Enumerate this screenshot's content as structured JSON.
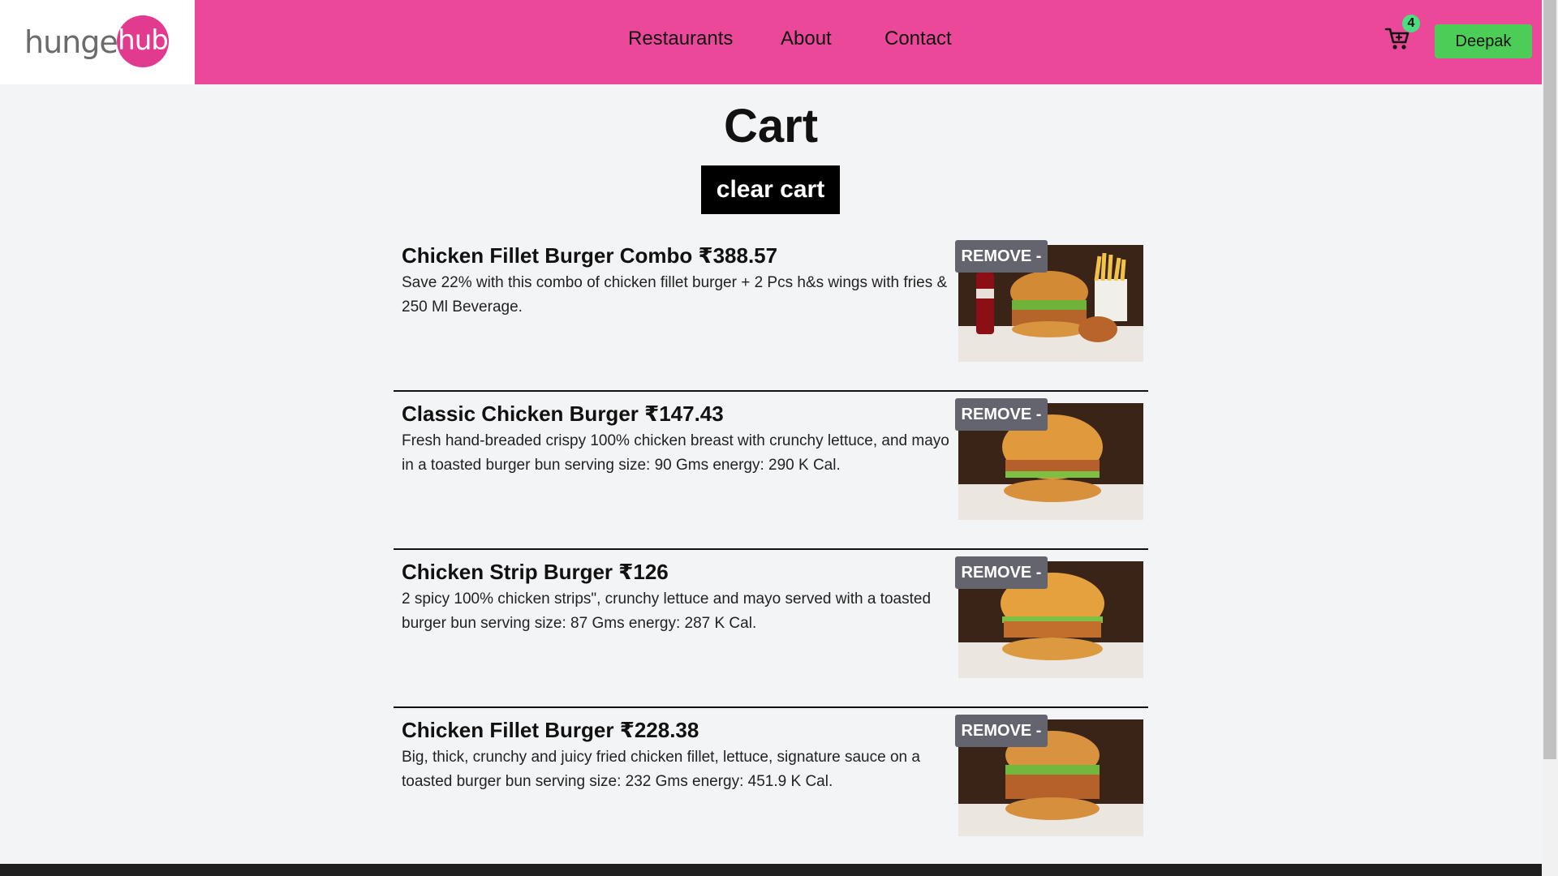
{
  "header": {
    "logo": {
      "left_text": "hunger",
      "right_text": "hub"
    },
    "nav": [
      {
        "label": "Restaurants"
      },
      {
        "label": "About"
      },
      {
        "label": "Contact"
      }
    ],
    "cart_count": "4",
    "user_label": "Deepak"
  },
  "main": {
    "title": "Cart",
    "clear_label": "clear cart",
    "items": [
      {
        "title": "Chicken Fillet Burger Combo ₹388.57",
        "description": "Save 22% with this combo of chicken fillet burger + 2 Pcs h&s wings with fries & 250 Ml Beverage.",
        "remove_label": "REMOVE -"
      },
      {
        "title": "Classic Chicken Burger ₹147.43",
        "description": "Fresh hand-breaded crispy 100% chicken breast with crunchy lettuce, and mayo in a toasted burger bun serving size: 90 Gms energy: 290 K Cal.",
        "remove_label": "REMOVE -"
      },
      {
        "title": "Chicken Strip Burger ₹126",
        "description": "2 spicy 100% chicken strips\", crunchy lettuce and mayo served with a toasted burger bun serving size: 87 Gms energy: 287 K Cal.",
        "remove_label": "REMOVE -"
      },
      {
        "title": "Chicken Fillet Burger ₹228.38",
        "description": "Big, thick, crunchy and juicy fried chicken fillet, lettuce, signature sauce on a toasted burger bun serving size: 232 Gms energy: 451.9 K Cal.",
        "remove_label": "REMOVE -"
      }
    ]
  },
  "colors": {
    "header": "#ec4899",
    "logo_circle": "#e23a8f",
    "user_button": "#4ccd57",
    "badge": "#4ade80",
    "remove_button": "#64646e"
  },
  "icons": [
    "cart-icon"
  ]
}
